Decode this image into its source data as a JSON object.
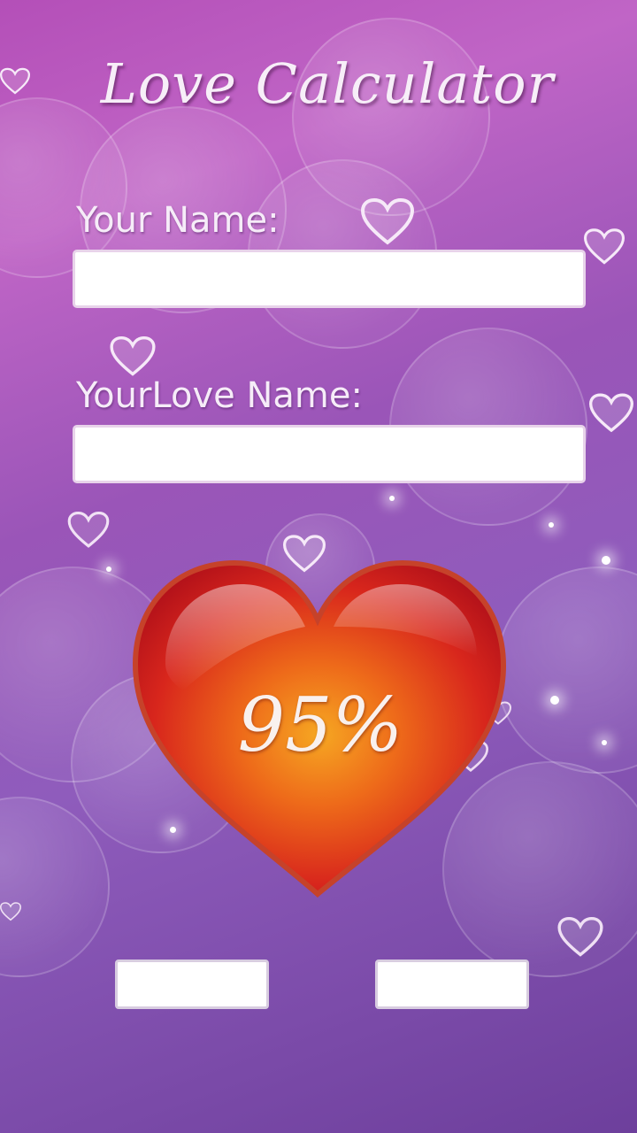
{
  "app": {
    "title": "Love Calculator"
  },
  "form": {
    "your_name_label": "Your Name:",
    "your_name_value": "",
    "love_name_label": "YourLove Name:",
    "love_name_value": ""
  },
  "result": {
    "percentage_text": "95%",
    "percentage": 95
  },
  "buttons": {
    "left_label": "",
    "right_label": ""
  },
  "colors": {
    "background_top": "#b44fb8",
    "background_bottom": "#6d3f9c",
    "heart_red": "#d41a1e",
    "heart_center": "#f39a1d",
    "text_light": "#f7eef8"
  },
  "icons": {
    "decor": "heart-outline-icon",
    "result": "heart-icon"
  }
}
